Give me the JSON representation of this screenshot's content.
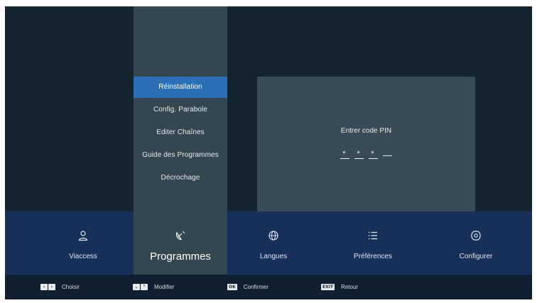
{
  "submenu": {
    "items": [
      {
        "label": "Réinstallation",
        "selected": true
      },
      {
        "label": "Config. Parabole",
        "selected": false
      },
      {
        "label": "Editer Chaînes",
        "selected": false
      },
      {
        "label": "Guide des Programmes",
        "selected": false
      },
      {
        "label": "Décrochage",
        "selected": false
      }
    ]
  },
  "pin": {
    "label": "Entrer code PIN",
    "chars": [
      "*",
      "*",
      "*",
      " "
    ]
  },
  "menu": {
    "items": [
      {
        "label": "Viaccess",
        "icon": "user-icon",
        "active": false
      },
      {
        "label": "Programmes",
        "icon": "satellite-dish-icon",
        "active": true
      },
      {
        "label": "Langues",
        "icon": "globe-icon",
        "active": false
      },
      {
        "label": "Préférences",
        "icon": "list-icon",
        "active": false
      },
      {
        "label": "Configurer",
        "icon": "gear-icon",
        "active": false
      }
    ]
  },
  "hints": [
    {
      "keys": [
        "‹",
        "›"
      ],
      "label": "Choisir"
    },
    {
      "keys": [
        "⌄",
        "⌃"
      ],
      "label": "Modifier"
    },
    {
      "keys": [
        "OK"
      ],
      "label": "Confirmer"
    },
    {
      "keys": [
        "EXIT"
      ],
      "label": "Retour"
    }
  ],
  "colors": {
    "background": "#15252f",
    "submenu_column": "#344650",
    "selected_item": "#2b6fb6",
    "pin_panel": "#394b55",
    "menu_bar": "#17305a",
    "hint_bar": "#102030"
  }
}
